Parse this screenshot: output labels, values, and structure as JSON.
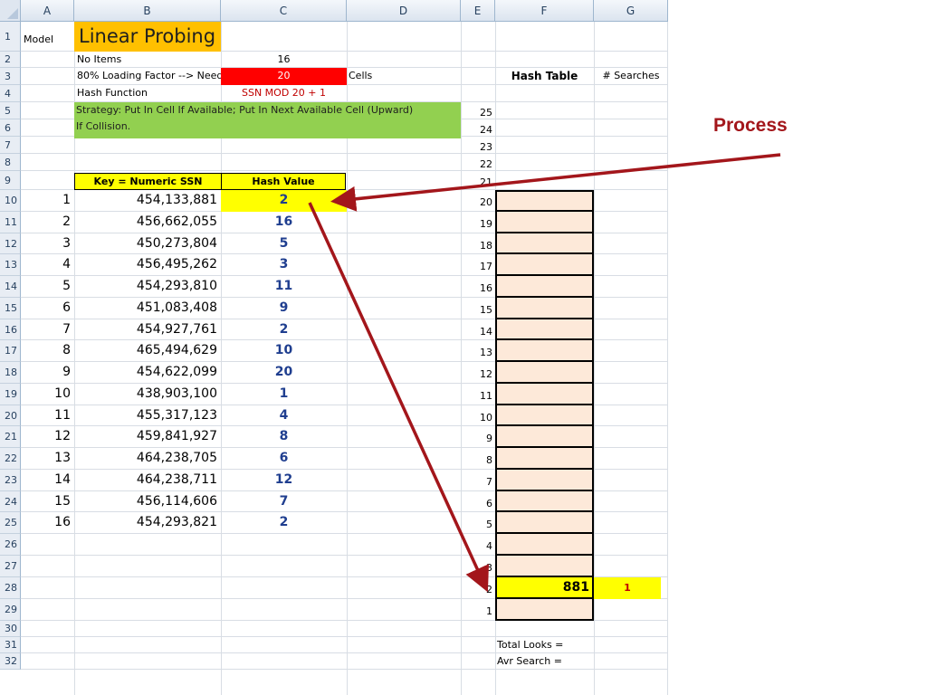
{
  "columns": [
    "A",
    "B",
    "C",
    "D",
    "E",
    "F",
    "G"
  ],
  "rows": [
    "1",
    "2",
    "3",
    "4",
    "5",
    "6",
    "7",
    "8",
    "9",
    "10",
    "11",
    "12",
    "13",
    "14",
    "15",
    "16",
    "17",
    "18",
    "19",
    "20",
    "21",
    "22",
    "23",
    "24",
    "25",
    "26",
    "27",
    "28",
    "29",
    "30",
    "31",
    "32"
  ],
  "sheet": {
    "a1": "Model",
    "title": "Linear Probing",
    "no_items_label": "No Items",
    "no_items_value": "16",
    "loading_label": "80% Loading Factor --> Need",
    "loading_value": "20",
    "cells_label": "Cells",
    "hash_fn_label": "Hash Function",
    "hash_fn_value": "SSN  MOD  20  + 1",
    "strategy_line1": "Strategy: Put In Cell If Available; Put In Next Available Cell (Upward)",
    "strategy_line2": "If Collision.",
    "key_header": "Key = Numeric SSN",
    "hash_header": "Hash Value",
    "hash_table_header": "Hash Table",
    "searches_header": "# Searches",
    "total_looks_label": "Total Looks =",
    "avr_search_label": "Avr Search ="
  },
  "records": [
    {
      "n": "1",
      "ssn": "454,133,881",
      "hash": "2"
    },
    {
      "n": "2",
      "ssn": "456,662,055",
      "hash": "16"
    },
    {
      "n": "3",
      "ssn": "450,273,804",
      "hash": "5"
    },
    {
      "n": "4",
      "ssn": "456,495,262",
      "hash": "3"
    },
    {
      "n": "5",
      "ssn": "454,293,810",
      "hash": "11"
    },
    {
      "n": "6",
      "ssn": "451,083,408",
      "hash": "9"
    },
    {
      "n": "7",
      "ssn": "454,927,761",
      "hash": "2"
    },
    {
      "n": "8",
      "ssn": "465,494,629",
      "hash": "10"
    },
    {
      "n": "9",
      "ssn": "454,622,099",
      "hash": "20"
    },
    {
      "n": "10",
      "ssn": "438,903,100",
      "hash": "1"
    },
    {
      "n": "11",
      "ssn": "455,317,123",
      "hash": "4"
    },
    {
      "n": "12",
      "ssn": "459,841,927",
      "hash": "8"
    },
    {
      "n": "13",
      "ssn": "464,238,705",
      "hash": "6"
    },
    {
      "n": "14",
      "ssn": "464,238,711",
      "hash": "12"
    },
    {
      "n": "15",
      "ssn": "456,114,606",
      "hash": "7"
    },
    {
      "n": "16",
      "ssn": "454,293,821",
      "hash": "2"
    }
  ],
  "slot_labels": [
    "25",
    "24",
    "23",
    "22",
    "21",
    "20",
    "19",
    "18",
    "17",
    "16",
    "15",
    "14",
    "13",
    "12",
    "11",
    "10",
    "9",
    "8",
    "7",
    "6",
    "5",
    "4",
    "3",
    "2",
    "1"
  ],
  "filled_slot": {
    "slot": "2",
    "value": "881",
    "searches": "1"
  },
  "annotation": {
    "label": "Process"
  },
  "colors": {
    "title_bg": "#ffc000",
    "need_bg": "#ff0000",
    "strategy_bg": "#92d050",
    "highlight": "#ffff00",
    "slot_bg": "#fde9d9",
    "arrow": "#a3161b",
    "hash_text": "#1f3e8f"
  }
}
